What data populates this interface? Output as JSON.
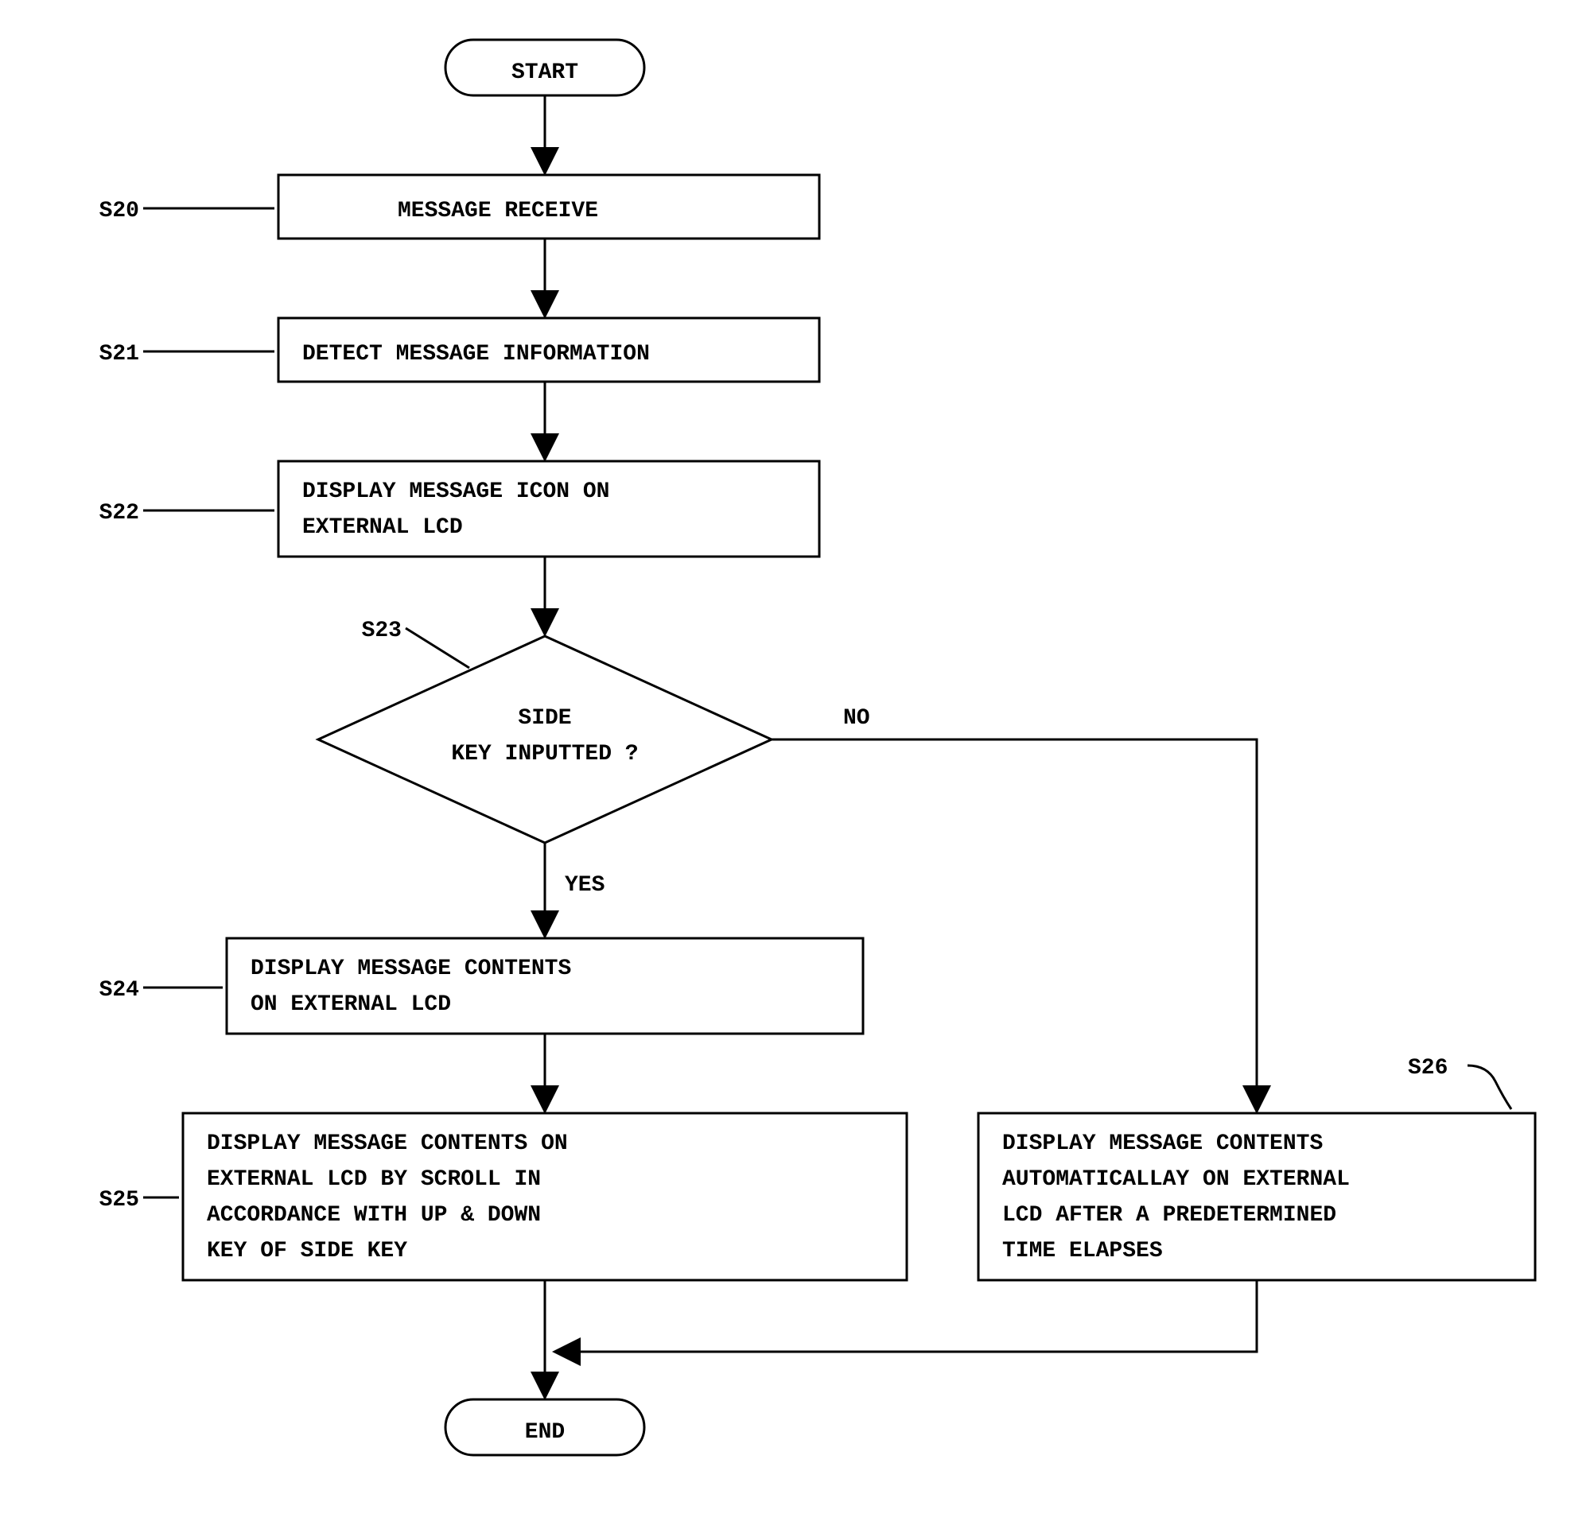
{
  "terminals": {
    "start": "START",
    "end": "END"
  },
  "steps": {
    "s20": {
      "label": "S20",
      "text": [
        "MESSAGE RECEIVE"
      ]
    },
    "s21": {
      "label": "S21",
      "text": [
        "DETECT MESSAGE INFORMATION"
      ]
    },
    "s22": {
      "label": "S22",
      "text": [
        "DISPLAY MESSAGE ICON ON",
        "EXTERNAL LCD"
      ]
    },
    "s23": {
      "label": "S23",
      "text": [
        "SIDE",
        "KEY INPUTTED ?"
      ]
    },
    "s24": {
      "label": "S24",
      "text": [
        "DISPLAY MESSAGE CONTENTS",
        "ON EXTERNAL LCD"
      ]
    },
    "s25": {
      "label": "S25",
      "text": [
        "DISPLAY MESSAGE CONTENTS ON",
        "EXTERNAL LCD BY SCROLL IN",
        "ACCORDANCE WITH UP & DOWN",
        "KEY OF SIDE KEY"
      ]
    },
    "s26": {
      "label": "S26",
      "text": [
        "DISPLAY MESSAGE CONTENTS",
        "AUTOMATICALLAY ON EXTERNAL",
        "LCD AFTER A PREDETERMINED",
        "TIME ELAPSES"
      ]
    }
  },
  "branches": {
    "yes": "YES",
    "no": "NO"
  }
}
